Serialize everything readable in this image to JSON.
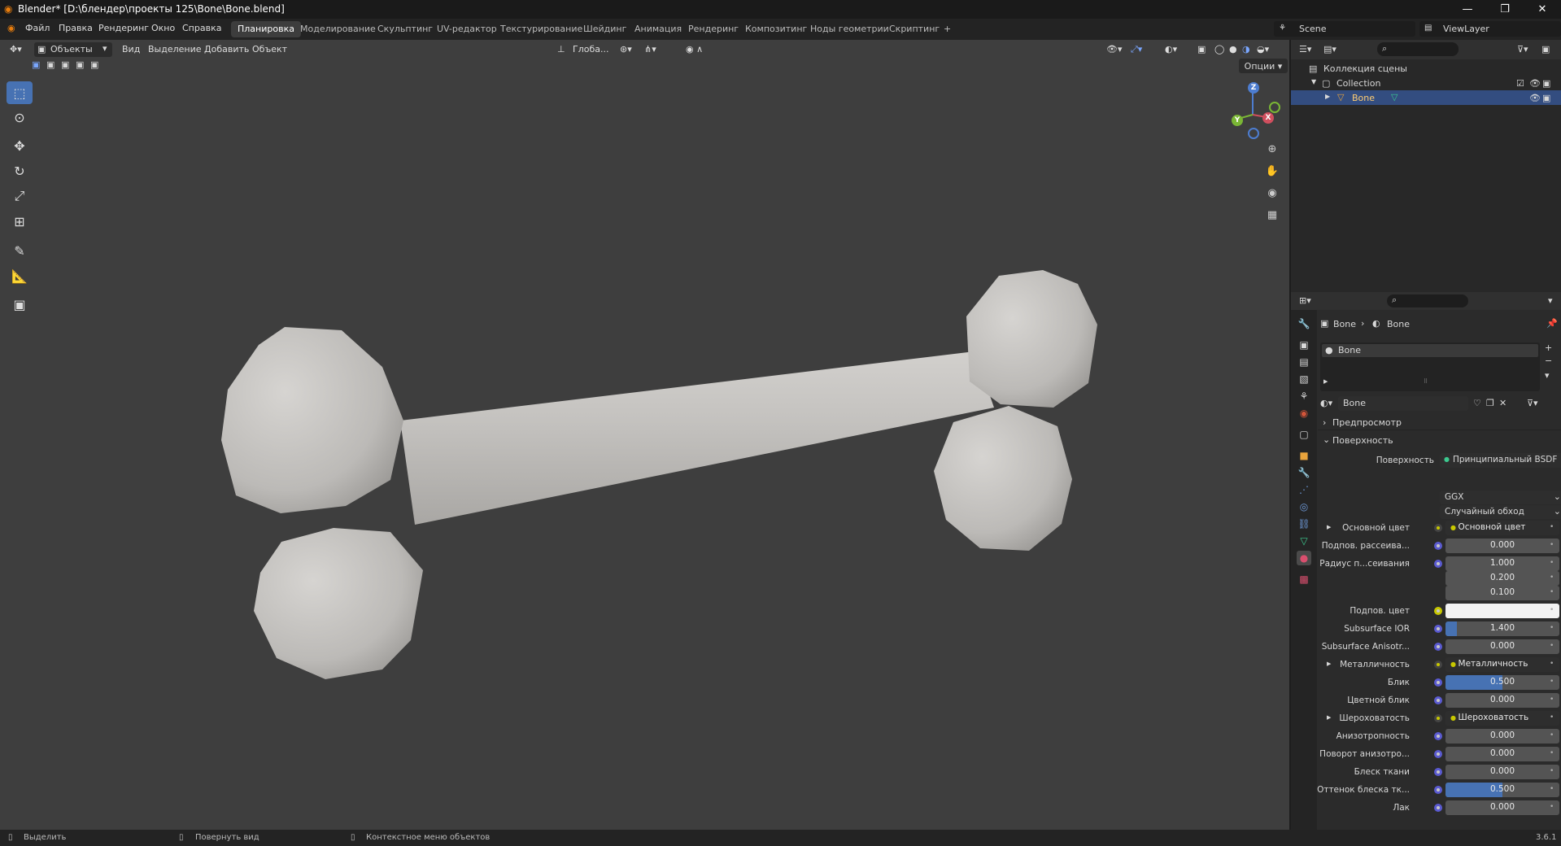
{
  "window": {
    "title": "Blender* [D:\\блендер\\проекты 125\\Bone\\Bone.blend]"
  },
  "menu": [
    "Файл",
    "Правка",
    "Рендеринг",
    "Окно",
    "Справка"
  ],
  "workspaces": [
    "Планировка",
    "Моделирование",
    "Скульптинг",
    "UV-редактор",
    "Текстурирование",
    "Шейдинг",
    "Анимация",
    "Рендеринг",
    "Композитинг",
    "Ноды геометрии",
    "Скриптинг",
    "+"
  ],
  "scene": {
    "name": "Scene",
    "view_layer": "ViewLayer"
  },
  "viewport": {
    "mode": "Объекты",
    "menus": [
      "Вид",
      "Выделение",
      "Добавить",
      "Объект"
    ],
    "transform": "Глоба...",
    "options": "Опции"
  },
  "outliner": {
    "root": "Коллекция сцены",
    "collection": "Collection",
    "object": "Bone"
  },
  "properties": {
    "breadcrumb": [
      "Bone",
      "Bone"
    ],
    "slot": "Bone",
    "material": "Bone",
    "panels": {
      "preview": "Предпросмотр",
      "surface": "Поверхность"
    },
    "surface_label": "Поверхность",
    "surface_value": "Принципиальный BSDF",
    "distribution": "GGX",
    "sss_method": "Случайный обход",
    "rows": [
      {
        "label": "Основной цвет",
        "value": "Основной цвет",
        "kind": "link",
        "expand": true
      },
      {
        "label": "Подпов. рассеива...",
        "value": "0.000",
        "kind": "num"
      },
      {
        "label": "Радиус п...сеивания",
        "value": "1.000",
        "kind": "num"
      },
      {
        "label": "",
        "value": "0.200",
        "kind": "num"
      },
      {
        "label": "",
        "value": "0.100",
        "kind": "num"
      },
      {
        "label": "Подпов. цвет",
        "value": "",
        "kind": "color"
      },
      {
        "label": "Subsurface IOR",
        "value": "1.400",
        "kind": "num",
        "fill": 0.1
      },
      {
        "label": "Subsurface Anisotr...",
        "value": "0.000",
        "kind": "num"
      },
      {
        "label": "Металличность",
        "value": "Металличность",
        "kind": "link",
        "expand": true
      },
      {
        "label": "Блик",
        "value": "0.500",
        "kind": "num",
        "fill": 0.5
      },
      {
        "label": "Цветной блик",
        "value": "0.000",
        "kind": "num"
      },
      {
        "label": "Шероховатость",
        "value": "Шероховатость",
        "kind": "link",
        "expand": true
      },
      {
        "label": "Анизотропность",
        "value": "0.000",
        "kind": "num"
      },
      {
        "label": "Поворот анизотро...",
        "value": "0.000",
        "kind": "num"
      },
      {
        "label": "Блеск ткани",
        "value": "0.000",
        "kind": "num"
      },
      {
        "label": "Оттенок блеска тк...",
        "value": "0.500",
        "kind": "num",
        "fill": 0.5
      },
      {
        "label": "Лак",
        "value": "0.000",
        "kind": "num"
      }
    ]
  },
  "status": {
    "select": "Выделить",
    "rotate": "Повернуть вид",
    "context": "Контекстное меню объектов",
    "version": "3.6.1"
  },
  "colors": {
    "accent": "#4772b3",
    "viewport_bg": "#3e3e3e",
    "bone": "#c8c6c3"
  }
}
